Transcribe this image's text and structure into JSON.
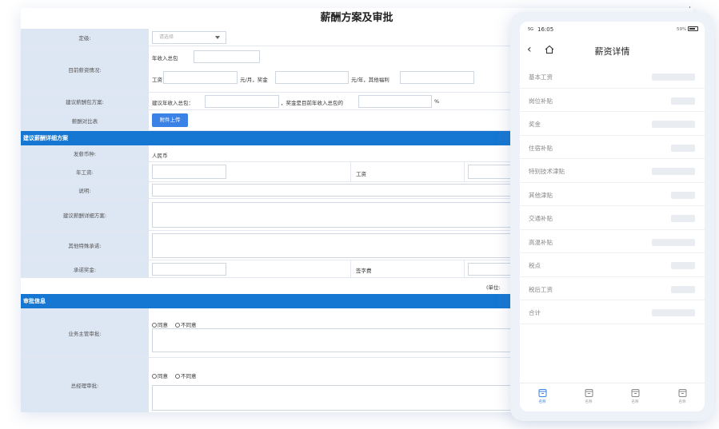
{
  "form": {
    "title": "薪酬方案及审批",
    "level_label": "定级:",
    "level_placeholder": "请选择",
    "current_salary_label": "目前薪资情况:",
    "annual_total_label": "年收入总包",
    "wage_label": "工资",
    "per_month_bonus": "元/月，奖金",
    "per_year_welfare": "元/年，其他福利",
    "proposal_label": "建议薪酬包方案:",
    "proposal_annual": "建议年收入总包：",
    "bonus_ratio": "，奖金是目前年收入总包的",
    "percent_sign": "%",
    "compare_label": "薪酬对比表",
    "upload_button": "附件上传",
    "section_detail": "建议薪酬详细方案",
    "currency_label": "发薪币种:",
    "currency_value": "人民币",
    "annual_wage_label": "年工资:",
    "wage_label2": "工资",
    "note_label": "说明:",
    "detail_plan_label": "建议薪酬详细方案:",
    "other_commit_label": "其他特殊承诺:",
    "commit_bonus_label": "承诺奖金:",
    "signing_fee_label": "签字费",
    "unit_label": "(单位:",
    "section_approval": "审批信息",
    "biz_approval_label": "业务主管审批:",
    "gm_approval_label": "总经理审批:",
    "agree": "同意",
    "disagree": "不同意"
  },
  "phone": {
    "time": "16:05",
    "signal": "5G",
    "battery": "59%",
    "title": "薪资详情",
    "items": [
      {
        "name": "基本工资",
        "bar": "wide"
      },
      {
        "name": "岗位补贴",
        "bar": "short"
      },
      {
        "name": "奖金",
        "bar": "wide"
      },
      {
        "name": "住宿补贴",
        "bar": "short"
      },
      {
        "name": "特别技术津贴",
        "bar": "wide"
      },
      {
        "name": "其他津贴",
        "bar": "short"
      },
      {
        "name": "交通补贴",
        "bar": "short"
      },
      {
        "name": "高温补贴",
        "bar": "wide"
      },
      {
        "name": "税点",
        "bar": "short"
      },
      {
        "name": "税后工资",
        "bar": "short"
      },
      {
        "name": "合计",
        "bar": "wide"
      }
    ],
    "tabs": [
      {
        "label": "名称"
      },
      {
        "label": "名称"
      },
      {
        "label": "名称"
      },
      {
        "label": "名称"
      }
    ],
    "accent_color": "#3b82e6"
  }
}
